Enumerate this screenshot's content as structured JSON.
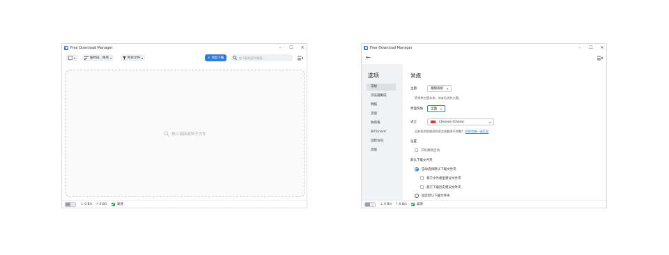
{
  "colors": {
    "accent": "#2f7bd8",
    "status_ok": "#1f9d55"
  },
  "window1": {
    "title": "Free Download Manager",
    "controls": {
      "minimize": "–",
      "maximize": "☐",
      "close": "✕"
    },
    "toolbar": {
      "sort_label": "按时间，降序",
      "filter_label": "所有文件",
      "add_label": "添加下载",
      "search_placeholder": "在下载内容中搜索..."
    },
    "drop_zone_text": "拖入链接或种子文件",
    "status": {
      "down_speed": "0 B/s",
      "up_speed": "0 B/s",
      "state": "高速"
    }
  },
  "window2": {
    "title": "Free Download Manager",
    "controls": {
      "minimize": "–",
      "maximize": "☐",
      "close": "✕"
    },
    "sidebar": {
      "title": "选项",
      "items": [
        "常规",
        "浏览器集成",
        "网络",
        "流速",
        "防病毒",
        "BitTorrent",
        "远程访问",
        "高级"
      ]
    },
    "content": {
      "title": "常规",
      "theme_label": "主题",
      "theme_value": "跟随系统",
      "theme_note": "更多种主题未来，待定坛优先主题。",
      "style_label": "界面风格",
      "style_value": "全面",
      "language_label": "语言",
      "language_value": "Chinese (China)",
      "language_note": "没有找到您使用的语言或翻译不完整？",
      "language_link": "帮助完善一键页面",
      "settings_heading": "设置",
      "autostart_label": "开机静默启动",
      "download_folder_heading": "默认下载文件夹",
      "radio_auto_label": "自动选择默认下载文件夹",
      "chk_filetype_label": "基于文件类型建议文件夹",
      "chk_history_label": "基于下载历史建议文件夹",
      "radio_fixed_label": "固定默认下载文件夹"
    },
    "status": {
      "down_speed": "0 B/s",
      "up_speed": "0 B/s",
      "state": "高速"
    }
  }
}
